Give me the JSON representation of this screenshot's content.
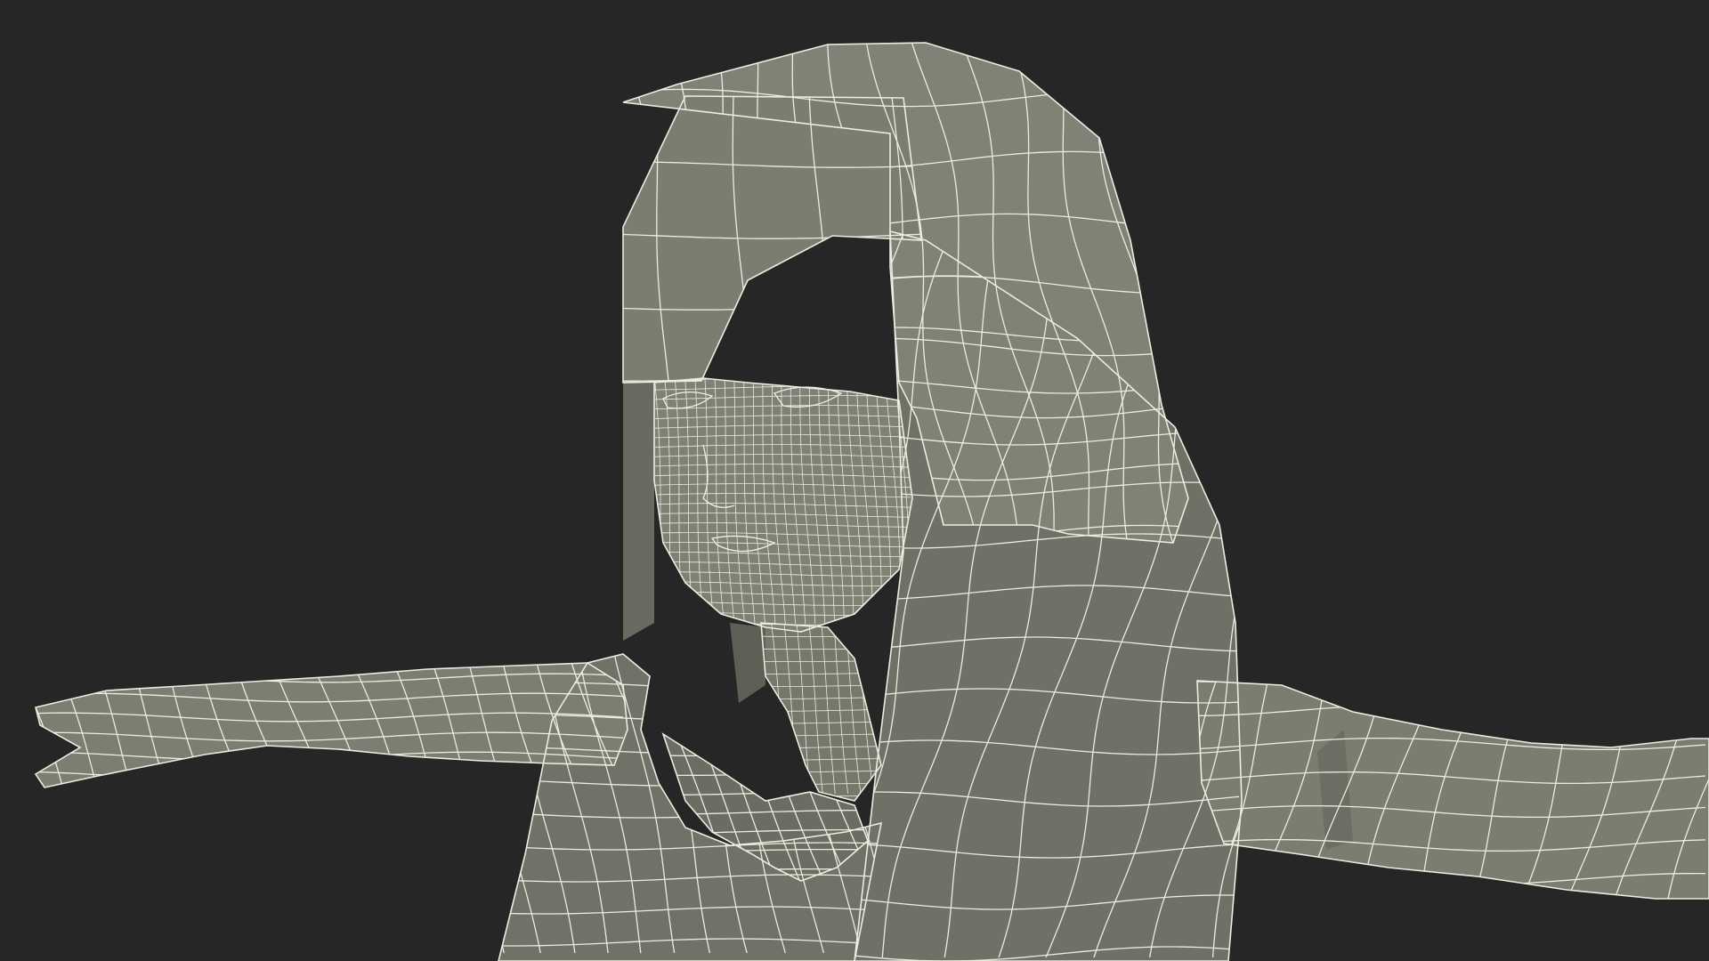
{
  "scene": {
    "background_color": "#262626",
    "surface_color": "#787a6e",
    "surface_dark_color": "#6a6c61",
    "surface_light_color": "#85877a",
    "wire_color": "#ecece0"
  }
}
